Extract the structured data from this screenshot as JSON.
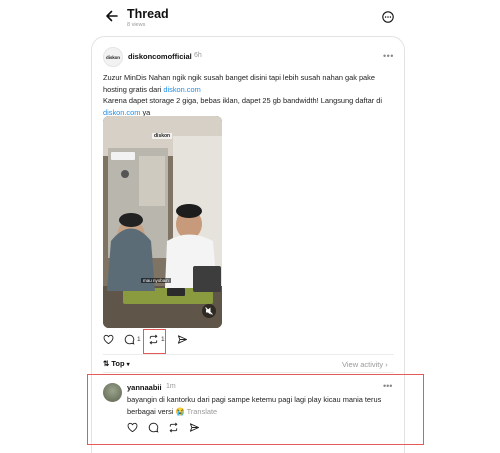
{
  "header": {
    "title": "Thread",
    "views": "8 views"
  },
  "post": {
    "avatar_text": "diskon",
    "username": "diskoncomofficial",
    "time": "6h",
    "text_part1": "Zuzur MinDis Nahan ngik ngik susah banget disini tapi lebih susah nahan gak pake hosting gratis dari ",
    "link1": "diskon.com",
    "text_part2": "Karena dapet storage 2 giga, bebas iklan, dapet 25 gb bandwidth! Langsung daftar di ",
    "link2": "diskon.com",
    "text_part3": " ya",
    "video": {
      "watermark": "diskon",
      "caption": "mau nyobain"
    },
    "actions": {
      "reply_count": "1",
      "repost_count": "1"
    }
  },
  "sort": {
    "label": "Top",
    "view_activity": "View activity"
  },
  "reply": {
    "username": "yannaabii",
    "time": "1m",
    "text": "bayangin di kantorku dari pagi sampe ketemu pagi lagi play kicau mania terus berbagai versi 😭",
    "translate": "Translate"
  },
  "colors": {
    "link": "#1d8ee8",
    "highlight": "#e25a5a",
    "muted": "#999999"
  }
}
